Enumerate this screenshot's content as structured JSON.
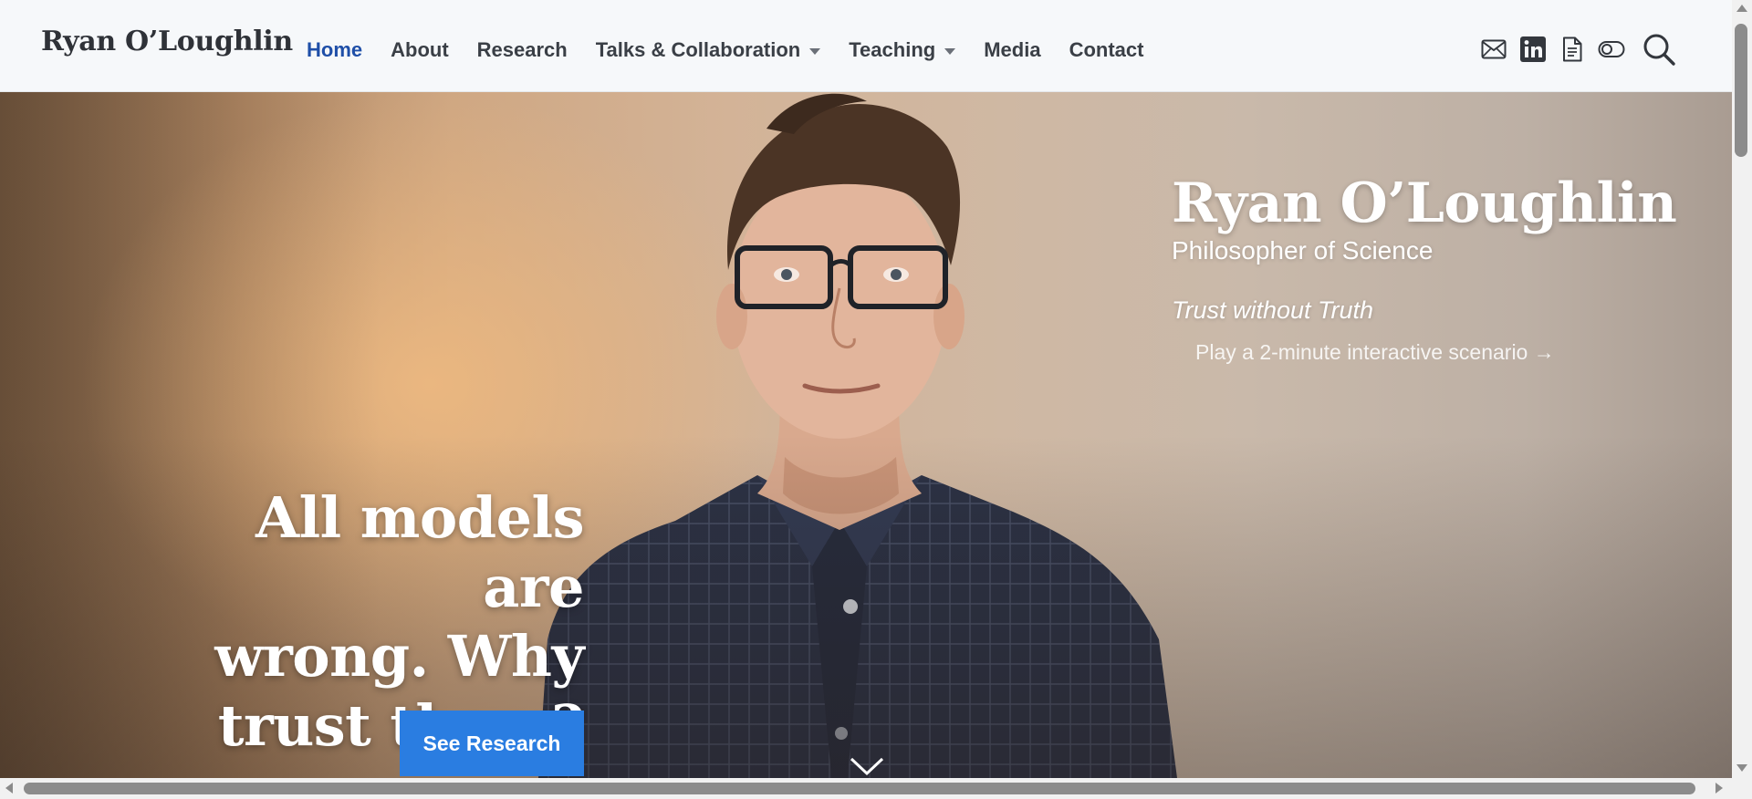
{
  "header": {
    "site_title": "Ryan O’Loughlin",
    "nav": [
      {
        "label": "Home",
        "active": true,
        "has_dropdown": false
      },
      {
        "label": "About",
        "active": false,
        "has_dropdown": false
      },
      {
        "label": "Research",
        "active": false,
        "has_dropdown": false
      },
      {
        "label": "Talks & Collaboration",
        "active": false,
        "has_dropdown": true
      },
      {
        "label": "Teaching",
        "active": false,
        "has_dropdown": true
      },
      {
        "label": "Media",
        "active": false,
        "has_dropdown": false
      },
      {
        "label": "Contact",
        "active": false,
        "has_dropdown": false
      }
    ],
    "icons": [
      "email-icon",
      "linkedin-icon",
      "cv-document-icon",
      "theme-toggle-icon",
      "search-icon"
    ]
  },
  "hero": {
    "name": "Ryan O’Loughlin",
    "subtitle": "Philosopher of Science",
    "tagline": "Trust without Truth",
    "link": "Play a 2-minute interactive scenario →",
    "headline_lines": [
      "All models are",
      "wrong. Why",
      "trust them?"
    ],
    "cta_label": "See Research",
    "scroll_icon": "chevron-down-icon"
  },
  "colors": {
    "header_bg": "#f6f8fa",
    "nav_active": "#1f4fa8",
    "nav_text": "#3a3f46",
    "cta_bg": "#2a7de1"
  },
  "scrollbars": {
    "vertical_position": 0,
    "horizontal_position": 0
  }
}
